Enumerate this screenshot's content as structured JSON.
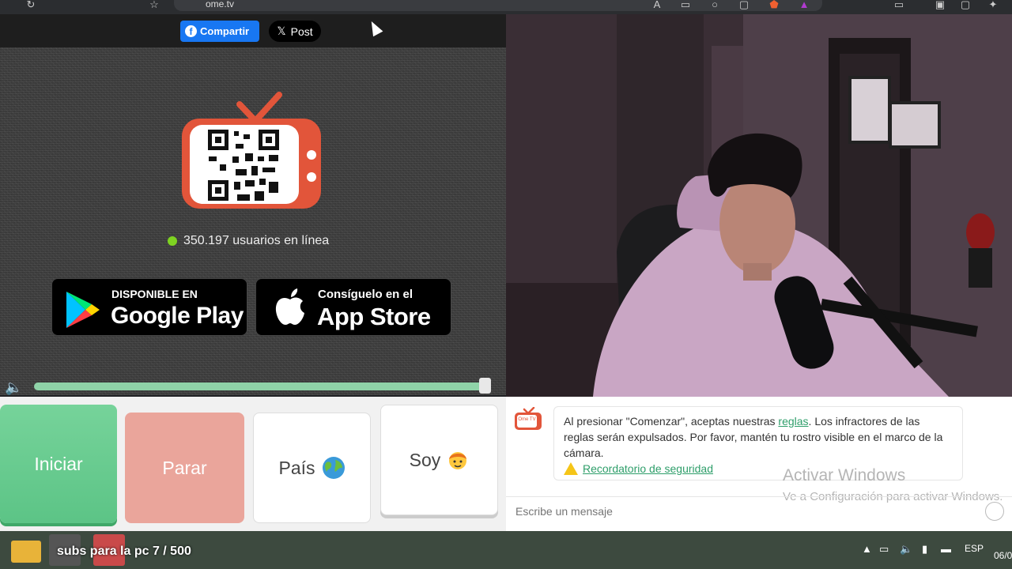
{
  "browser": {
    "url": "ome.tv"
  },
  "share": {
    "facebook_label": "Compartir",
    "x_label": "Post"
  },
  "status": {
    "online_text": "350.197 usuarios en línea"
  },
  "stores": {
    "google": {
      "small": "DISPONIBLE EN",
      "big": "Google Play"
    },
    "apple": {
      "small": "Consíguelo en el",
      "big": "App Store"
    }
  },
  "volume": {
    "level": 0.99
  },
  "controls": {
    "start_label": "Iniciar",
    "stop_label": "Parar",
    "country_label": "País",
    "me_label": "Soy"
  },
  "chat": {
    "logo_text": "Ome TV",
    "message_pre": "Al presionar \"Comenzar\", aceptas nuestras ",
    "rules_link": "reglas",
    "message_post": ". Los infractores de las reglas serán expulsados. Por favor, mantén tu rostro visible en el marco de la cámara.",
    "safety_link": "Recordatorio de seguridad",
    "input_placeholder": "Escribe un mensaje"
  },
  "watermark": {
    "line1": "Activar Windows",
    "line2": "Ve a Configuración para activar Windows."
  },
  "taskbar": {
    "caption": "subs para la pc 7 / 500",
    "language": "ESP",
    "clock": "06/0"
  },
  "colors": {
    "start": "#5cc486",
    "stop": "#eaa59b",
    "link": "#2e9e6a",
    "facebook": "#1877f2"
  }
}
